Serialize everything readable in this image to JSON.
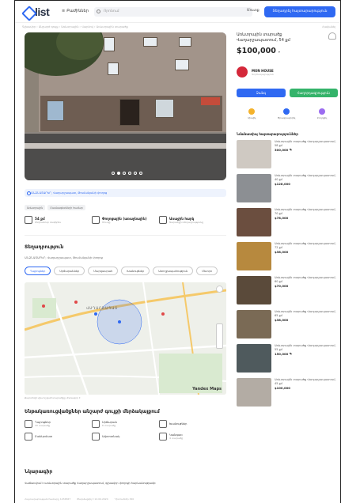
{
  "header": {
    "logo_text": "list",
    "categories_label": "Բաժիններ",
    "search_placeholder": "Որոնում",
    "login_label": "Մուտք",
    "post_button": "Տեղադրել հայտարարություն"
  },
  "breadcrumb": "Գլխավոր › Անշարժ գույք › Առևտրային › Վարձով › Առևտրային տարածք",
  "favorite_top": "Հավանել",
  "gallery": {
    "dots_total": 6,
    "dot_active": 1
  },
  "address_bar": "ԱՆՁՆԱՏԱՐԵՐ, Վաղարշապատ, Թումանյանի փողոց",
  "tags": [
    "Առևտրային",
    "Մասնագետների համար"
  ],
  "features": [
    {
      "title": "54 քմ",
      "sub": "Ընդհանուր մակերես"
    },
    {
      "title": "Փողոցային (առաջնային)",
      "sub": "Մուտք"
    },
    {
      "title": "Առաջին հարկ",
      "sub": "Տարածքի տեղադրությունը"
    }
  ],
  "location": {
    "title": "Տեղադրություն",
    "address": "ԱՆՁՆԱՏԱՐԵՐ, Վաղարշապատ, Թումանյանի փողոց",
    "tabs": [
      "Դպրոցներ",
      "Սրճարաններ",
      "Մարզասրահ",
      "Խանութներ",
      "Առողջապահություն",
      "Մետրո"
    ],
    "active_tab": 0,
    "map_city_label": "ՎԱՂԱՐՇԱՊԱՏ",
    "map_brand": "Yandex Maps",
    "map_note": "Քարտեզի վրա նշված տարածքը մոտավոր է"
  },
  "infrastructure": {
    "title": "Ենթակառուցվածքներ անշարժ գույքի մերձակայքում",
    "items": [
      {
        "title": "Դպրոցներ",
        "sub": "10 տարածք"
      },
      {
        "title": "Սրճարան",
        "sub": "6 տարածք"
      },
      {
        "title": "Խանութներ",
        "sub": ""
      },
      {
        "title": "Բանկոմատ",
        "sub": ""
      },
      {
        "title": "Ավտոտնակ",
        "sub": ""
      },
      {
        "title": "Կանգառ",
        "sub": "4 տարածք"
      }
    ]
  },
  "description": {
    "title": "Նկարագիր",
    "text": "Վաճառվում է առևտրային տարածք Վաղարշապատում, գլխավոր փողոցի հարևանությամբ:",
    "meta": [
      "Հայտարարության համարը 1234567",
      "Թարմացվել է 12.04.2024",
      "Դիտումներ 320"
    ]
  },
  "listing": {
    "title": "Առևտրային տարածք Վաղարշապատում, 54 քմ",
    "price": "$100,000",
    "currency_toggle": "▾",
    "seller_name": "MON HOUSE",
    "seller_sub": "Գործակալություն",
    "call_button": "Զանգ",
    "message_button": "Հաղորդագրություն",
    "actions": [
      {
        "label": "Կիսվել",
        "color": "#f4b22b"
      },
      {
        "label": "Ծրագրավորել",
        "color": "#2f69f2"
      },
      {
        "label": "Բողոքել",
        "color": "#9b6cf0"
      }
    ]
  },
  "similar": {
    "title": "Նմանատիպ հայտարարություններ",
    "items": [
      {
        "title": "Առևտրային տարածք Վաղարշապատում, 58 քմ",
        "price": "300,000 ֏",
        "color": "#cfc9c2"
      },
      {
        "title": "Առևտրային տարածք Վաղարշապատում, 40 քմ",
        "price": "$128,000",
        "color": "#8c8f93"
      },
      {
        "title": "Առևտրային տարածք Վաղարշապատում, 70 քմ",
        "price": "$78,000",
        "color": "#6b4e3f"
      },
      {
        "title": "Առևտրային տարածք Վաղարշապատում, 72 քմ",
        "price": "$38,000",
        "color": "#b7893e"
      },
      {
        "title": "Առևտրային տարածք Վաղարշապատում, 60 քմ",
        "price": "$70,000",
        "color": "#5a4a3a"
      },
      {
        "title": "Առևտրային տարածք Վաղարշապատում, 65 քմ",
        "price": "$38,000",
        "color": "#7a6a55"
      },
      {
        "title": "Առևտրային տարածք Վաղարշապատում, 55 քմ",
        "price": "150,000 ֏",
        "color": "#4f5a5d"
      },
      {
        "title": "Առևտրային տարածք Վաղարշապատում, 45 քմ",
        "price": "$100,000",
        "color": "#b3aca4"
      }
    ]
  }
}
